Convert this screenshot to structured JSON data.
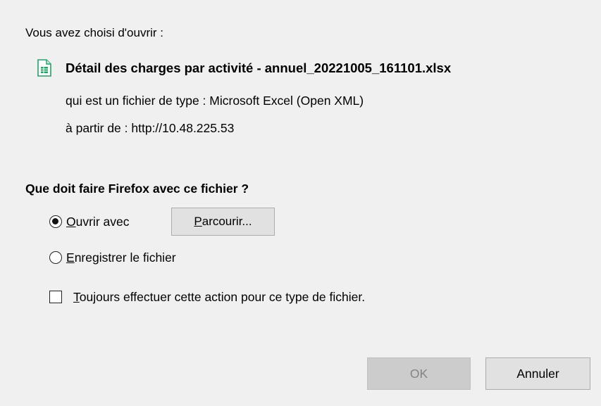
{
  "dialog": {
    "intro": "Vous avez choisi d'ouvrir :",
    "file_name": "Détail des charges par activité - annuel_20221005_161101.xlsx",
    "type_line": "qui est un fichier de type : Microsoft Excel (Open XML)",
    "from_line": "à partir de : http://10.48.225.53",
    "question": "Que doit faire Firefox avec ce fichier ?",
    "file_icon": "spreadsheet-file-icon",
    "open_with": {
      "accesskey": "O",
      "label_rest": "uvrir avec",
      "checked": true
    },
    "browse": {
      "accesskey": "P",
      "label_rest": "arcourir..."
    },
    "save_file": {
      "accesskey": "E",
      "label_rest": "nregistrer le fichier",
      "checked": false
    },
    "always": {
      "accesskey": "T",
      "label_rest": "oujours effectuer cette action pour ce type de fichier.",
      "checked": false
    },
    "ok_label": "OK",
    "cancel_label": "Annuler"
  },
  "colors": {
    "background": "#f0f0f0",
    "icon_green": "#21a366",
    "disabled_text": "#838383"
  }
}
